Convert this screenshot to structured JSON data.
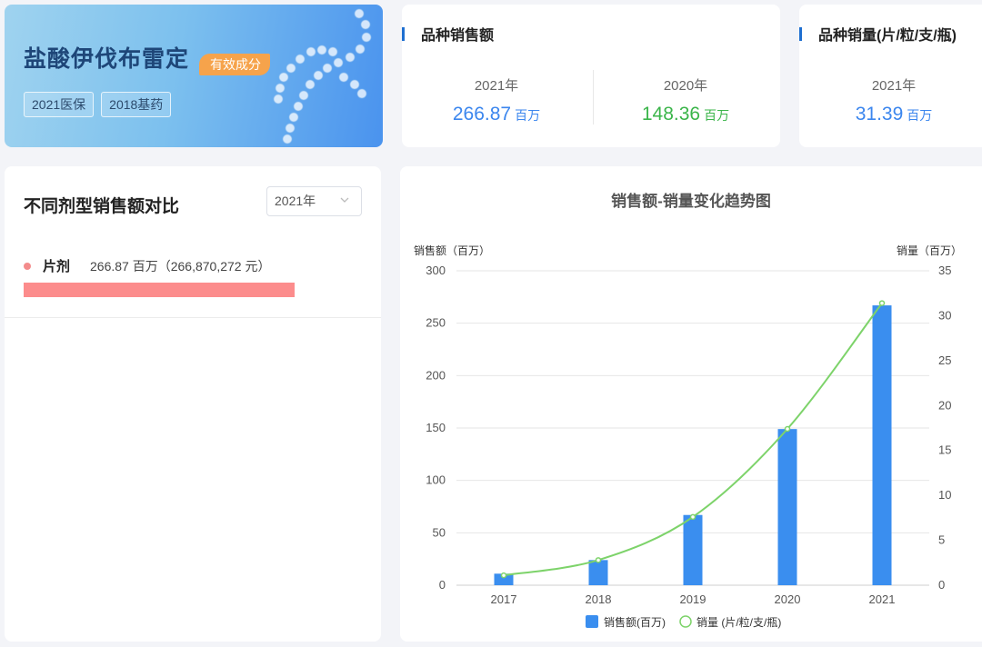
{
  "hero": {
    "title": "盐酸伊伐布雷定",
    "badge": "有效成分",
    "tags": [
      "2021医保",
      "2018基药"
    ]
  },
  "sales_card": {
    "title": "品种销售额",
    "items": [
      {
        "year": "2021年",
        "value": "266.87",
        "unit": "百万",
        "color": "#3b86ee"
      },
      {
        "year": "2020年",
        "value": "148.36",
        "unit": "百万",
        "color": "#3bb54a"
      }
    ]
  },
  "volume_card": {
    "title": "品种销量(片/粒/支/瓶)",
    "items": [
      {
        "year": "2021年",
        "value": "31.39",
        "unit": "百万",
        "color": "#3b86ee"
      }
    ]
  },
  "dosage_panel": {
    "title": "不同剂型销售额对比",
    "year_select": "2021年",
    "rows": [
      {
        "name": "片剂",
        "value_text": "266.87 百万（266,870,272 元）",
        "share": 1.0,
        "color": "#fc8c8c"
      }
    ]
  },
  "chart_data": {
    "type": "bar+line",
    "title": "销售额-销量变化趋势图",
    "categories": [
      "2017",
      "2018",
      "2019",
      "2020",
      "2021"
    ],
    "y_left": {
      "label": "销售额（百万）",
      "min": 0,
      "max": 300,
      "ticks": [
        0,
        50,
        100,
        150,
        200,
        250,
        300
      ]
    },
    "y_right": {
      "label": "销量（百万）",
      "min": 0,
      "max": 35,
      "ticks": [
        0,
        5,
        10,
        15,
        20,
        25,
        30,
        35
      ]
    },
    "series": [
      {
        "name": "销售额(百万)",
        "type": "bar",
        "axis": "left",
        "color": "#3a8eef",
        "values": [
          11,
          24,
          67,
          149,
          267
        ]
      },
      {
        "name": "销量 (片/粒/支/瓶)",
        "type": "line",
        "axis": "right",
        "color": "#7dd36a",
        "values": [
          1.1,
          2.8,
          7.6,
          17.4,
          31.4
        ]
      }
    ],
    "grid": true,
    "legend": "bottom"
  }
}
